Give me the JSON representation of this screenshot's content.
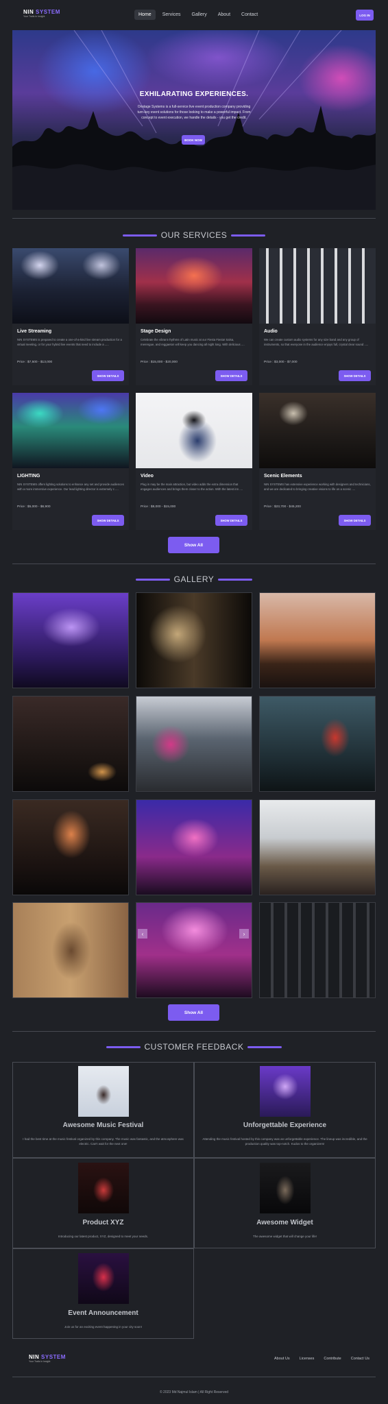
{
  "brand": {
    "name_part1": "NIN",
    "name_part2": "SYSTEM",
    "tagline": "Your Trails in Insight"
  },
  "nav": {
    "links": [
      "Home",
      "Services",
      "Gallery",
      "About",
      "Contact"
    ],
    "login": "LOG IN"
  },
  "hero": {
    "title": "EXHILARATING EXPERIENCES.",
    "text": "Onstage Systems is a full-service live event production company providing turn-key event solutions for those looking to make a powerful impact. From concept to event execution, we handle the details - you get the credit.",
    "button": "BOOK NOW"
  },
  "services": {
    "title": "OUR SERVICES",
    "cards": [
      {
        "title": "Live Streaming",
        "desc": "NIN SYSTEMS is prepared to create a one-of-a-kind live stream production for a virtual meeting, or for your hybrid live events that need to include a .....",
        "price": "Price : $7,500 - $13,000",
        "button": "SHOW DETAILS"
      },
      {
        "title": "Stage Design",
        "desc": "Celebrate the vibrant rhythms of Latin music at our Fiesta Fiesta! Salsa, merengue, and reggaeton will keep you dancing all night long. With delicious ....",
        "price": "Price : $15,000 - $20,000",
        "button": "SHOW DETAILS"
      },
      {
        "title": "Audio",
        "desc": "We can create custom audio systems for any size band and any group of instruments, so that everyone in the audience enjoys full, crystal clear sound .....",
        "price": "Price : $3,000 - $7,000",
        "button": "SHOW DETAILS"
      },
      {
        "title": "LIGHTING",
        "desc": "NIN SYSTEMS offers lighting solutions to enhance any set and provide audiences with a more immersive experience. Our lead lighting director is extremely c ....",
        "price": "Price : $5,000 - $6,900",
        "button": "SHOW DETAILS"
      },
      {
        "title": "Video",
        "desc": "Plug in may be the main attraction, but video adds the extra dimension that engages audiences and brings them closer to the action. With the latest inn ....",
        "price": "Price : $8,000 - $15,000",
        "button": "SHOW DETAILS"
      },
      {
        "title": "Scenic Elements",
        "desc": "NIN SYSTEMS has extensive experience working with designers and technicians, and we are dedicated to bringing creative visions to life on a scenic ....",
        "price": "Price : $23,700 - $45,200",
        "button": "SHOW DETAILS"
      }
    ],
    "show_all": "Show All"
  },
  "gallery": {
    "title": "GALLERY",
    "show_all": "Show All"
  },
  "feedback": {
    "title": "CUSTOMER FEEDBACK",
    "items": [
      {
        "title": "Awesome Music Festival",
        "text": "I had the best time at the music festival organized by this company. The music was fantastic, and the atmosphere was electric. Can't wait for the next one!"
      },
      {
        "title": "Unforgettable Experience",
        "text": "Attending the music festival hosted by this company was an unforgettable experience. The lineup was incredible, and the production quality was top-notch. Kudos to the organizers!"
      },
      {
        "title": "Product XYZ",
        "text": "Introducing our latest product, XYZ, designed to meet your needs."
      },
      {
        "title": "Awesome Widget",
        "text": "The awesome widget that will change your life!"
      },
      {
        "title": "Event Announcement",
        "text": "Join us for an exciting event happening in your city soon!"
      }
    ]
  },
  "footer": {
    "links": [
      "About Us",
      "Licenses",
      "Contribute",
      "Contact Us"
    ],
    "copyright": "© 2023 Md Najmul Islam | All Right Reserved"
  },
  "colors": {
    "accent": "#7c5cf0",
    "background": "#1f2126",
    "card": "#23252b"
  }
}
